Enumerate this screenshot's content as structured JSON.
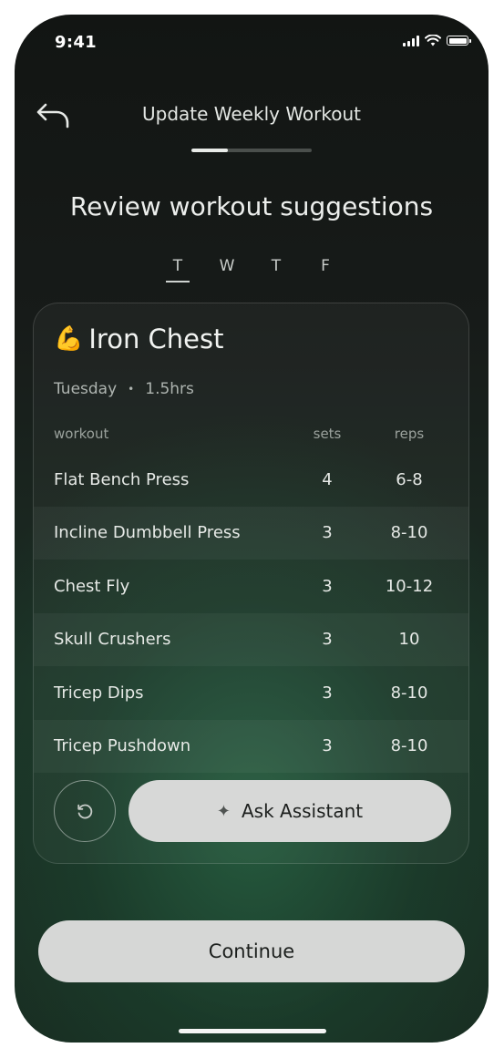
{
  "status_bar": {
    "time": "9:41"
  },
  "header": {
    "title": "Update Weekly Workout",
    "progress": 0.3
  },
  "heading": "Review workout suggestions",
  "days": [
    {
      "label": "T",
      "active": true
    },
    {
      "label": "W",
      "active": false
    },
    {
      "label": "T",
      "active": false
    },
    {
      "label": "F",
      "active": false
    }
  ],
  "card": {
    "emoji": "💪",
    "title": "Iron Chest",
    "day": "Tuesday",
    "separator": "•",
    "duration": "1.5hrs",
    "columns": {
      "workout": "workout",
      "sets": "sets",
      "reps": "reps"
    },
    "rows": [
      {
        "name": "Flat Bench Press",
        "sets": "4",
        "reps": "6-8"
      },
      {
        "name": "Incline Dumbbell Press",
        "sets": "3",
        "reps": "8-10"
      },
      {
        "name": "Chest Fly",
        "sets": "3",
        "reps": "10-12"
      },
      {
        "name": "Skull Crushers",
        "sets": "3",
        "reps": "10"
      },
      {
        "name": "Tricep Dips",
        "sets": "3",
        "reps": "8-10"
      },
      {
        "name": "Tricep Pushdown",
        "sets": "3",
        "reps": "8-10"
      }
    ],
    "ask_label": "Ask Assistant"
  },
  "continue_label": "Continue",
  "icons": {
    "back": "back-arrow-icon",
    "undo": "undo-icon",
    "sparkle": "sparkle-icon",
    "signal": "signal-icon",
    "wifi": "wifi-icon",
    "battery": "battery-icon"
  }
}
